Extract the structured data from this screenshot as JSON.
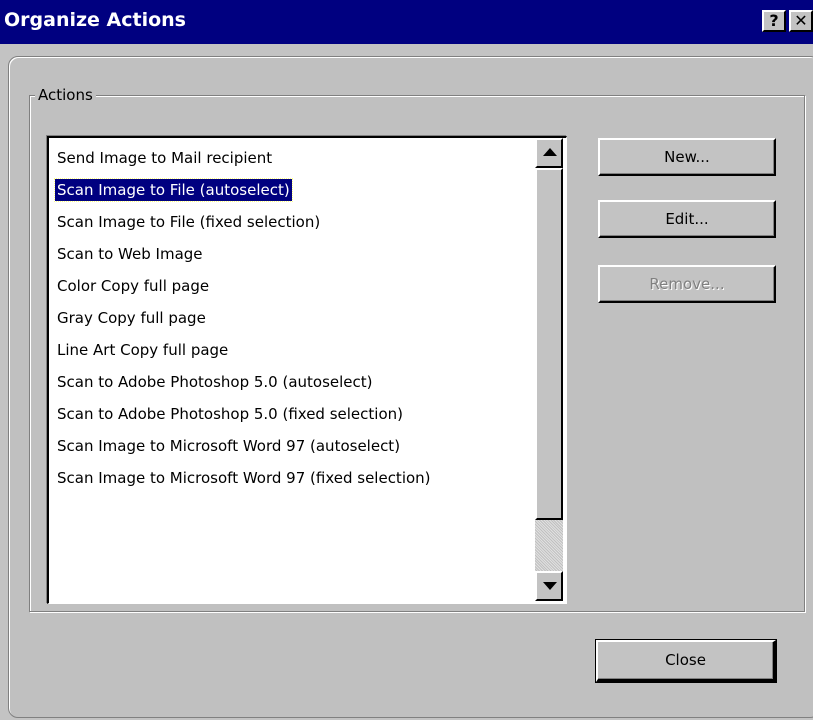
{
  "window": {
    "title": "Organize Actions",
    "help_button": "?",
    "close_button": "✕"
  },
  "actions_group": {
    "label": "Actions",
    "items": [
      {
        "label": "Send Image to Mail recipient",
        "selected": false
      },
      {
        "label": "Scan Image to File (autoselect)",
        "selected": true
      },
      {
        "label": "Scan Image to File (fixed selection)",
        "selected": false
      },
      {
        "label": "Scan to Web Image",
        "selected": false
      },
      {
        "label": "Color Copy full page",
        "selected": false
      },
      {
        "label": "Gray Copy full page",
        "selected": false
      },
      {
        "label": "Line Art Copy full page",
        "selected": false
      },
      {
        "label": "Scan to Adobe Photoshop 5.0 (autoselect)",
        "selected": false
      },
      {
        "label": "Scan to Adobe Photoshop 5.0 (fixed selection)",
        "selected": false
      },
      {
        "label": "Scan Image to Microsoft Word 97 (autoselect)",
        "selected": false
      },
      {
        "label": "Scan Image to Microsoft Word 97 (fixed selection)",
        "selected": false
      }
    ]
  },
  "buttons": {
    "new_label": "New...",
    "edit_label": "Edit...",
    "remove_label": "Remove...",
    "remove_enabled": false,
    "close_label": "Close"
  },
  "colors": {
    "titlebar": "#000080",
    "selection": "#000080",
    "face": "#c3c3c3"
  }
}
